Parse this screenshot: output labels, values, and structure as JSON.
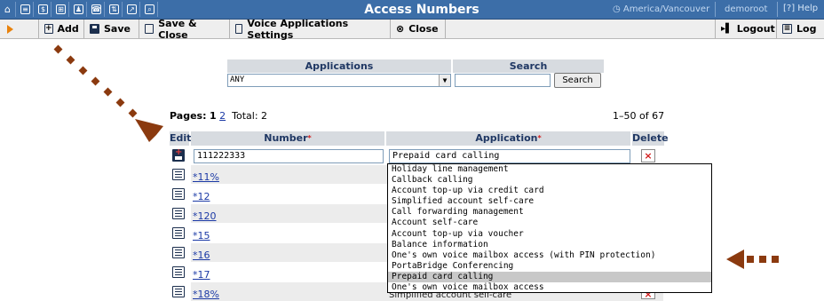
{
  "titlebar": {
    "title": "Access Numbers",
    "timezone": "America/Vancouver",
    "user": "demoroot",
    "help": "Help"
  },
  "toolbar": {
    "add": "Add",
    "save": "Save",
    "save_close": "Save & Close",
    "voice_settings": "Voice Applications Settings",
    "close": "Close",
    "logout": "Logout",
    "log": "Log"
  },
  "search": {
    "applications_header": "Applications",
    "search_header": "Search",
    "applications_value": "ANY",
    "search_value": "",
    "search_button": "Search"
  },
  "pagination": {
    "label": "Pages:",
    "current": "1",
    "next": "2",
    "total": "Total: 2",
    "range": "1–50 of 67"
  },
  "table": {
    "headers": {
      "edit": "Edit",
      "number": "Number",
      "application": "Application",
      "delete": "Delete"
    },
    "new_row": {
      "number": "111222333",
      "application": "Prepaid card calling"
    },
    "rows": [
      {
        "number": "*11%"
      },
      {
        "number": "*12"
      },
      {
        "number": "*120"
      },
      {
        "number": "*15"
      },
      {
        "number": "*16"
      },
      {
        "number": "*17"
      },
      {
        "number": "*18%",
        "application": "Simplified account self-care"
      }
    ]
  },
  "dropdown": {
    "options": [
      "Holiday line management",
      "Callback calling",
      "Account top-up via credit card",
      "Simplified account self-care",
      "Call forwarding management",
      "Account self-care",
      "Account top-up via voucher",
      "Balance information",
      "One's own voice mailbox access (with PIN protection)",
      "PortaBridge Conferencing",
      "Prepaid card calling",
      "One's own voice mailbox access"
    ],
    "selected_index": 10
  },
  "colors": {
    "titlebar": "#3c6ea8",
    "arrow": "#8b3a0f",
    "header": "#d7dbe0"
  }
}
